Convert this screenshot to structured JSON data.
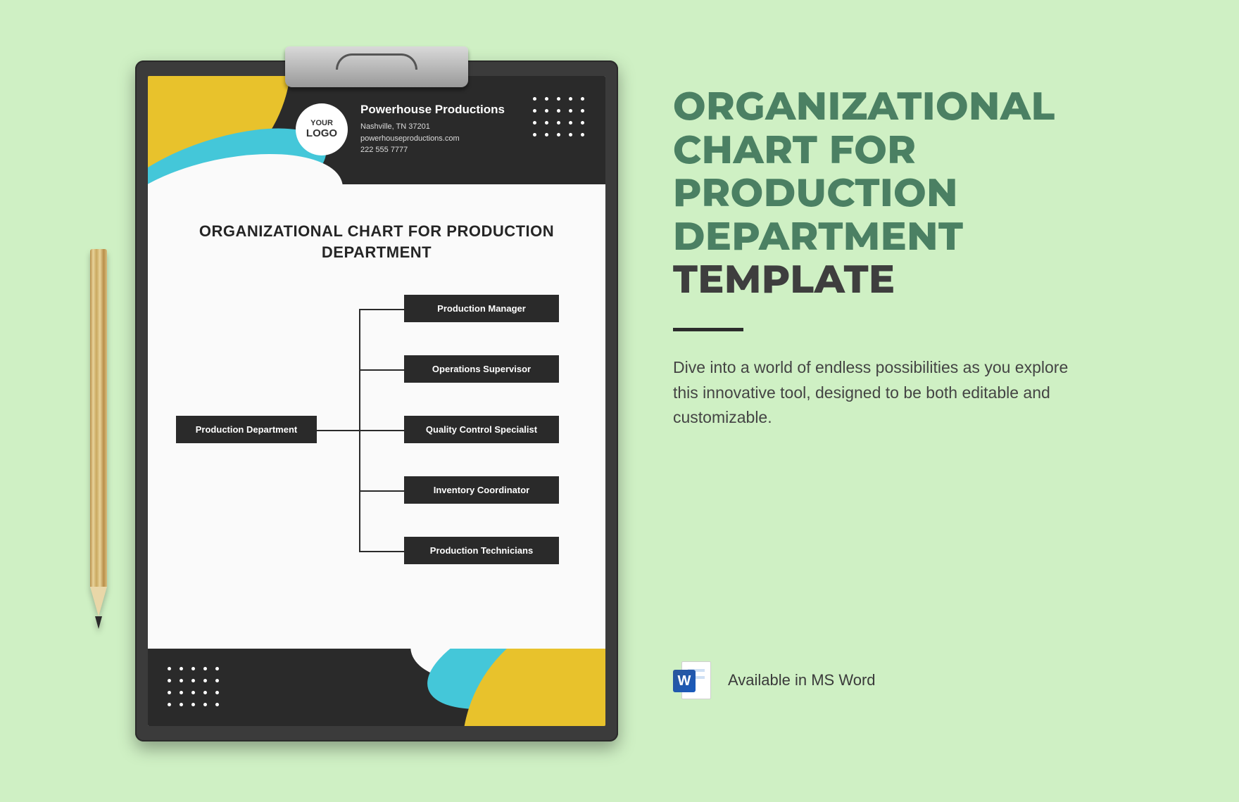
{
  "title": {
    "line1": "ORGANIZATIONAL",
    "line2": "CHART FOR",
    "line3": "PRODUCTION",
    "line4": "DEPARTMENT",
    "line5": "TEMPLATE"
  },
  "description": "Dive into a world of endless possibilities as you explore this innovative tool, designed to be both editable and customizable.",
  "availability": {
    "label": "Available in MS Word",
    "icon_letter": "W"
  },
  "document": {
    "logo": {
      "line1": "YOUR",
      "line2": "LOGO"
    },
    "company": {
      "name": "Powerhouse Productions",
      "address": "Nashville, TN 37201",
      "website": "powerhouseproductions.com",
      "phone": "222 555 7777"
    },
    "doc_heading": "ORGANIZATIONAL CHART FOR PRODUCTION DEPARTMENT"
  },
  "chart_data": {
    "type": "tree",
    "root": "Production Department",
    "children": [
      "Production Manager",
      "Operations Supervisor",
      "Quality Control Specialist",
      "Inventory Coordinator",
      "Production Technicians"
    ]
  },
  "colors": {
    "bg": "#cff0c4",
    "title_green": "#4b8063",
    "title_gray": "#3e3e3e",
    "node": "#2a2a2a",
    "yellow": "#e8c22c",
    "teal": "#44c7d9"
  }
}
